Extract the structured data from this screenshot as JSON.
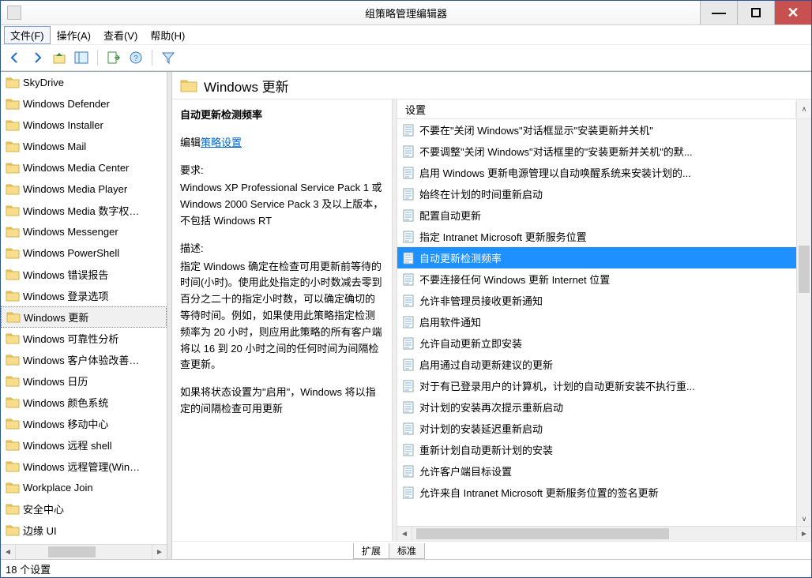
{
  "window": {
    "title": "组策略管理编辑器"
  },
  "menu": {
    "file": "文件(F)",
    "action": "操作(A)",
    "view": "查看(V)",
    "help": "帮助(H)"
  },
  "tree": {
    "selectedIndex": 11,
    "items": [
      "SkyDrive",
      "Windows Defender",
      "Windows Installer",
      "Windows Mail",
      "Windows Media Center",
      "Windows Media Player",
      "Windows Media 数字权…",
      "Windows Messenger",
      "Windows PowerShell",
      "Windows 错误报告",
      "Windows 登录选项",
      "Windows 更新",
      "Windows 可靠性分析",
      "Windows 客户体验改善…",
      "Windows 日历",
      "Windows 颜色系统",
      "Windows 移动中心",
      "Windows 远程 shell",
      "Windows 远程管理(Win…",
      "Workplace Join",
      "安全中心",
      "边缘 UI"
    ]
  },
  "header": {
    "title": "Windows 更新"
  },
  "description": {
    "title": "自动更新检测频率",
    "editPrefix": "编辑",
    "editLink": "策略设置",
    "reqLabel": "要求:",
    "reqBody": "Windows XP Professional Service Pack 1 或 Windows 2000 Service Pack 3 及以上版本，不包括 Windows RT",
    "descLabel": "描述:",
    "descBody": "指定 Windows 确定在检查可用更新前等待的时间(小时)。使用此处指定的小时数减去零到百分之二十的指定小时数，可以确定确切的等待时间。例如，如果使用此策略指定检测频率为 20 小时，则应用此策略的所有客户端将以 16 到 20 小时之间的任何时间为间隔检查更新。",
    "descBody2": "如果将状态设置为\"启用\"，Windows 将以指定的间隔检查可用更新"
  },
  "list": {
    "columnHeader": "设置",
    "selectedIndex": 6,
    "items": [
      "不要在\"关闭 Windows\"对话框显示\"安装更新并关机\"",
      "不要调整\"关闭 Windows\"对话框里的\"安装更新并关机\"的默...",
      "启用 Windows 更新电源管理以自动唤醒系统来安装计划的...",
      "始终在计划的时间重新启动",
      "配置自动更新",
      "指定 Intranet Microsoft 更新服务位置",
      "自动更新检测频率",
      "不要连接任何 Windows 更新 Internet 位置",
      "允许非管理员接收更新通知",
      "启用软件通知",
      "允许自动更新立即安装",
      "启用通过自动更新建议的更新",
      "对于有已登录用户的计算机，计划的自动更新安装不执行重...",
      "对计划的安装再次提示重新启动",
      "对计划的安装延迟重新启动",
      "重新计划自动更新计划的安装",
      "允许客户端目标设置",
      "允许来自 Intranet Microsoft 更新服务位置的签名更新"
    ]
  },
  "tabs": {
    "extended": "扩展",
    "standard": "标准"
  },
  "status": {
    "text": "18 个设置"
  }
}
